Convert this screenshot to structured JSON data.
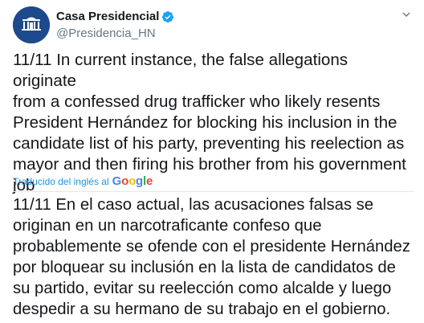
{
  "tweet": {
    "author_name": "Casa Presidencial",
    "handle": "@Presidencia_HN",
    "text_lines": [
      "11/11 In current instance, the false allegations originate",
      "from a confessed drug trafficker who likely resents",
      "President Hernández for blocking his inclusion in the",
      "candidate list of his party, preventing his reelection as",
      "mayor and then firing his brother from his government",
      "job"
    ],
    "translated_by_label": "Traducido del inglés al",
    "translation_provider": "Google",
    "translation_lines": [
      "11/11 En el caso actual, las acusaciones falsas se",
      "originan en un narcotraficante confeso que",
      "probablemente se ofende con el presidente Hernández",
      "por bloquear su inclusión en la lista de candidatos de",
      "su partido, evitar su reelección como alcalde y luego",
      "despedir a su hermano de su trabajo en el gobierno."
    ]
  },
  "icons": {
    "verified": "verified-badge-icon",
    "caret": "chevron-down-icon",
    "avatar": "presidential-house-logo"
  },
  "colors": {
    "text": "#14171a",
    "secondary": "#657786",
    "link": "#1b95e0",
    "verified": "#1da1f2",
    "avatar_bg": "#1d4a8c"
  }
}
